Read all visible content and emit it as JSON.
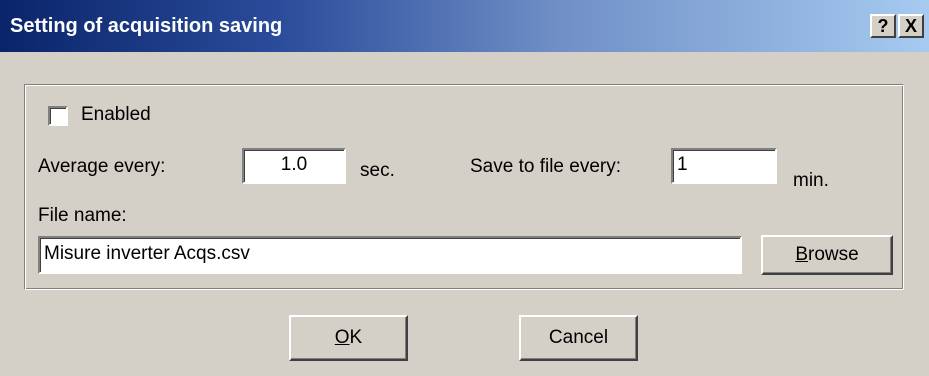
{
  "window": {
    "title": "Setting of acquisition saving",
    "help_button": "?",
    "close_button": "X"
  },
  "form": {
    "enabled_label": "Enabled",
    "enabled_checked": false,
    "average_label": "Average every:",
    "average_value": "1.0",
    "average_unit": "sec.",
    "save_label": "Save to file every:",
    "save_value": "1",
    "save_unit": "min.",
    "file_name_label": "File name:",
    "file_name_value": "Misure inverter Acqs.csv",
    "browse_first": "B",
    "browse_rest": "rowse"
  },
  "buttons": {
    "ok_first": "O",
    "ok_rest": "K",
    "cancel": "Cancel"
  }
}
